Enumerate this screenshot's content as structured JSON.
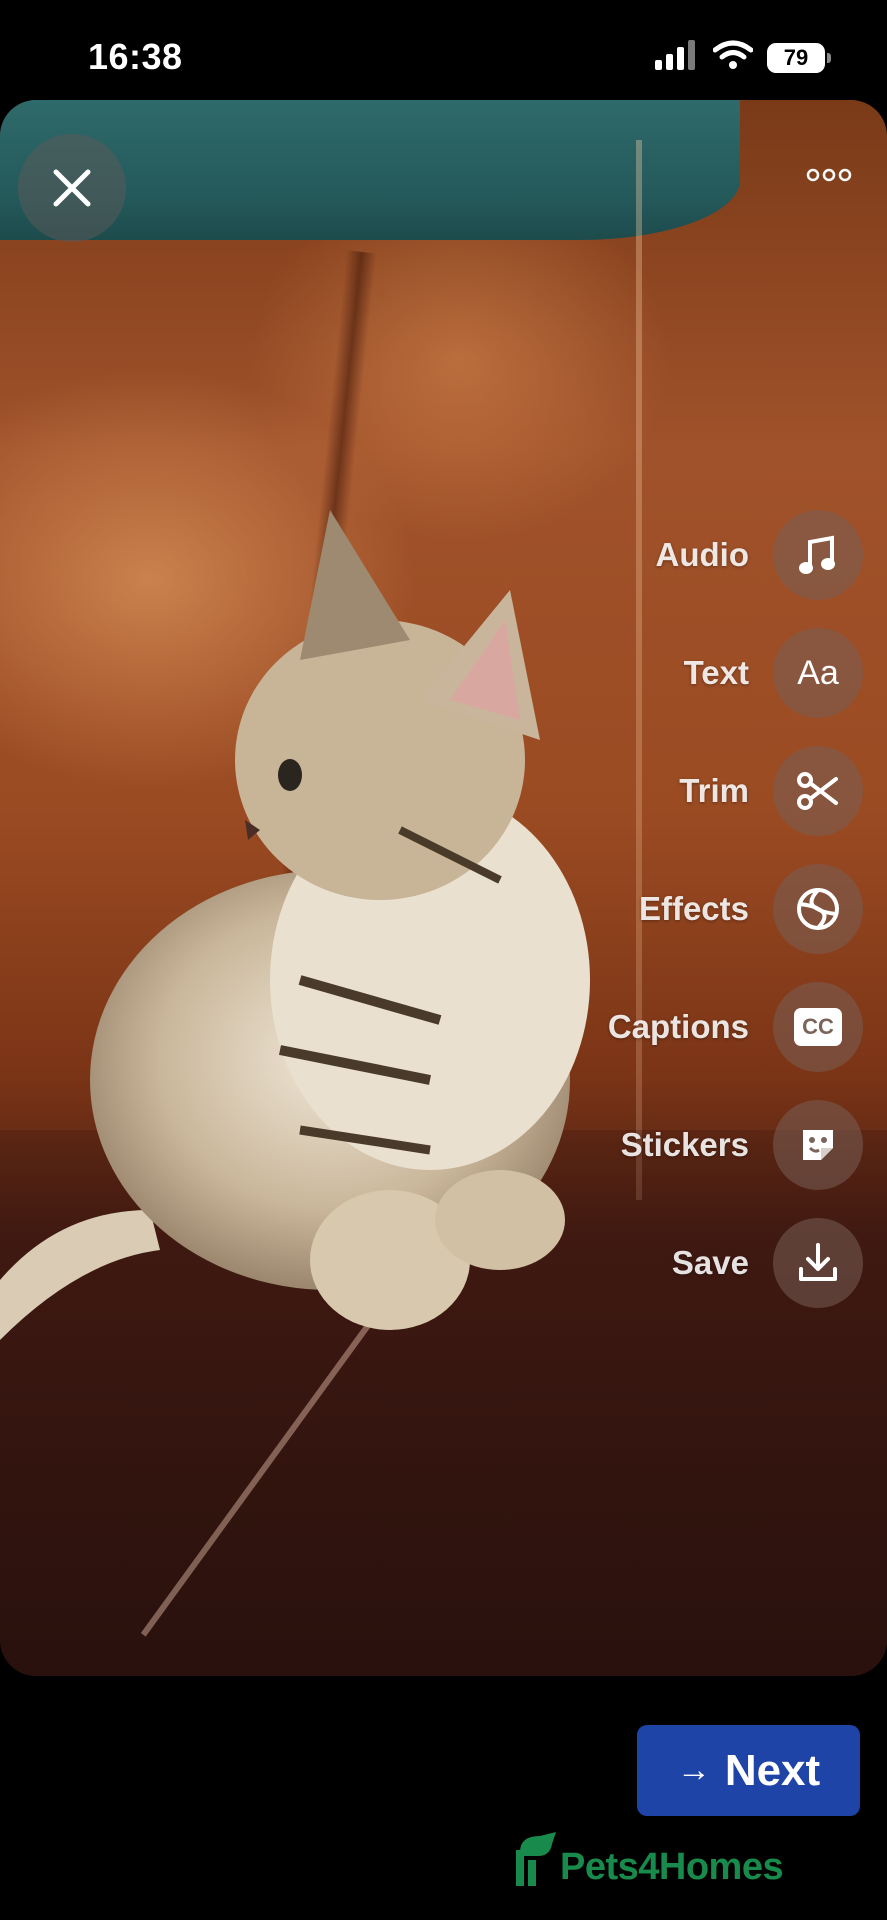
{
  "status_bar": {
    "time": "16:38",
    "battery": "79",
    "icons": [
      "signal-icon",
      "wifi-icon",
      "battery-icon"
    ]
  },
  "top_bar": {
    "close_icon": "close-icon",
    "more_icon": "more-icon"
  },
  "tools": [
    {
      "label": "Audio",
      "icon": "music-note-icon"
    },
    {
      "label": "Text",
      "icon": "text-aa-icon"
    },
    {
      "label": "Trim",
      "icon": "scissors-icon"
    },
    {
      "label": "Effects",
      "icon": "effects-aperture-icon"
    },
    {
      "label": "Captions",
      "icon": "captions-cc-icon"
    },
    {
      "label": "Stickers",
      "icon": "sticker-icon"
    },
    {
      "label": "Save",
      "icon": "download-icon"
    }
  ],
  "captions_icon_text": "CC",
  "text_icon_text": "Aa",
  "next_button": {
    "label": "Next",
    "arrow": "→",
    "color": "#1d44a6"
  },
  "watermark": {
    "text": "Pets4Homes",
    "color": "#178a4c"
  }
}
